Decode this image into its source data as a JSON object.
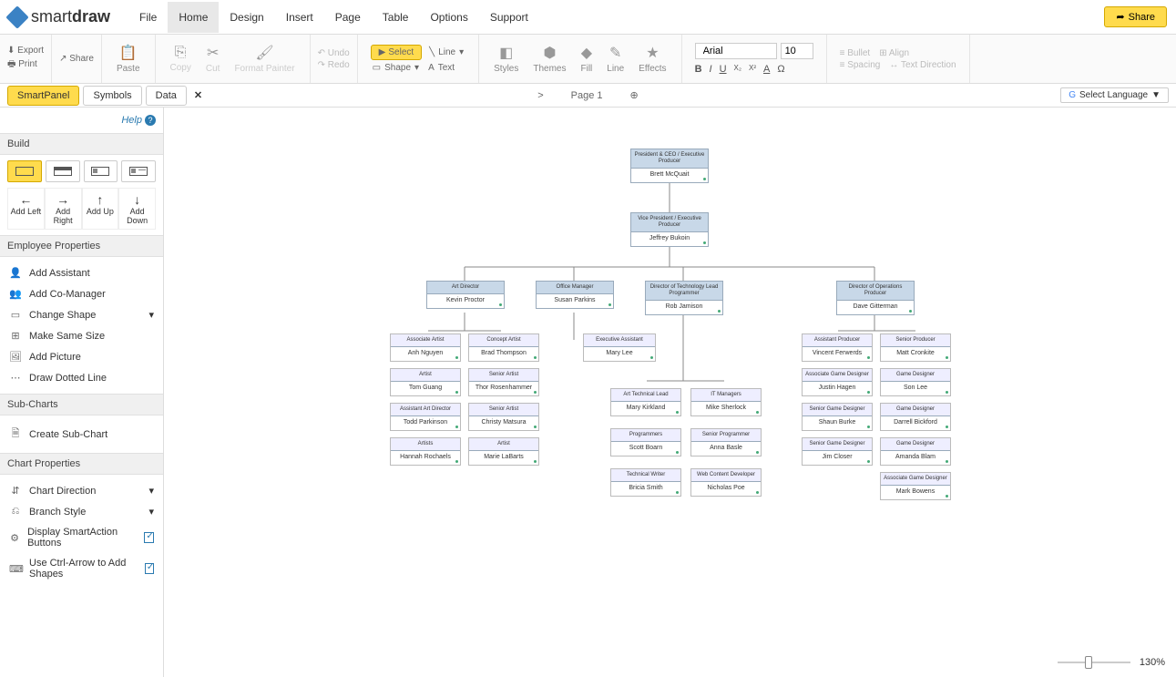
{
  "logo": {
    "brand1": "smart",
    "brand2": "draw"
  },
  "menu": [
    "File",
    "Home",
    "Design",
    "Insert",
    "Page",
    "Table",
    "Options",
    "Support"
  ],
  "menu_active": 1,
  "share": "Share",
  "ribbon": {
    "export": "Export",
    "share": "Share",
    "print": "Print",
    "paste": "Paste",
    "copy": "Copy",
    "cut": "Cut",
    "format_painter": "Format Painter",
    "undo": "Undo",
    "redo": "Redo",
    "select": "Select",
    "shape": "Shape",
    "line": "Line",
    "text": "Text",
    "styles": "Styles",
    "themes": "Themes",
    "fill": "Fill",
    "line_tool": "Line",
    "effects": "Effects",
    "font": "Arial",
    "font_size": "10",
    "bullet": "Bullet",
    "align": "Align",
    "spacing": "Spacing",
    "text_direction": "Text Direction"
  },
  "panel_tabs": [
    "SmartPanel",
    "Symbols",
    "Data"
  ],
  "panel_active": 0,
  "page_label": "Page 1",
  "lang_label": "Select Language",
  "sidebar": {
    "help": "Help",
    "build": "Build",
    "add_left": "Add Left",
    "add_right": "Add Right",
    "add_up": "Add Up",
    "add_down": "Add Down",
    "emp_props": "Employee Properties",
    "add_assistant": "Add Assistant",
    "add_comanager": "Add Co-Manager",
    "change_shape": "Change Shape",
    "make_same": "Make Same Size",
    "add_picture": "Add Picture",
    "draw_dotted": "Draw Dotted Line",
    "subcharts": "Sub-Charts",
    "create_subchart": "Create Sub-Chart",
    "chart_props": "Chart Properties",
    "chart_direction": "Chart Direction",
    "branch_style": "Branch Style",
    "show_smart": "Display SmartAction Buttons",
    "ctrl_arrow": "Use Ctrl-Arrow to Add Shapes"
  },
  "zoom": "130%",
  "org": {
    "ceo": {
      "title": "President & CEO / Executive Producer",
      "name": "Brett McQuait"
    },
    "vp": {
      "title": "Vice President / Executive Producer",
      "name": "Jeffrey Bukoin"
    },
    "dirs": [
      {
        "title": "Art Director",
        "name": "Kevin Proctor"
      },
      {
        "title": "Office Manager",
        "name": "Susan Parkins"
      },
      {
        "title": "Director of Technology Lead Programmer",
        "name": "Rob Jamison"
      },
      {
        "title": "Director of Operations Producer",
        "name": "Dave Gitterman"
      }
    ],
    "col_art_a": [
      {
        "title": "Associate Artist",
        "name": "Anh Nguyen"
      },
      {
        "title": "Artist",
        "name": "Tom Guang"
      },
      {
        "title": "Assistant Art Director",
        "name": "Todd Parkinson"
      },
      {
        "title": "Artists",
        "name": "Hannah Rochaels"
      }
    ],
    "col_art_b": [
      {
        "title": "Concept Artist",
        "name": "Brad Thompson"
      },
      {
        "title": "Senior Artist",
        "name": "Thor Rosenhammer"
      },
      {
        "title": "Senior Artist",
        "name": "Christy Matsura"
      },
      {
        "title": "Artist",
        "name": "Marie LaBarts"
      }
    ],
    "office_assist": {
      "title": "Executive Assistant",
      "name": "Mary Lee"
    },
    "col_tech_a": [
      {
        "title": "Art Technical Lead",
        "name": "Mary Kirkland"
      },
      {
        "title": "Programmers",
        "name": "Scott Boarn"
      },
      {
        "title": "Technical Writer",
        "name": "Bricia Smith"
      }
    ],
    "col_tech_b": [
      {
        "title": "IT Managers",
        "name": "Mike Sherlock"
      },
      {
        "title": "Senior Programmer",
        "name": "Anna Basle"
      },
      {
        "title": "Web Content Developer",
        "name": "Nicholas Poe"
      }
    ],
    "col_ops_a": [
      {
        "title": "Assistant Producer",
        "name": "Vincent Ferwerds"
      },
      {
        "title": "Associate Game Designer",
        "name": "Justin Hagen"
      },
      {
        "title": "Senior Game Designer",
        "name": "Shaun Burke"
      },
      {
        "title": "Senior Game Designer",
        "name": "Jim Closer"
      }
    ],
    "col_ops_b": [
      {
        "title": "Senior Producer",
        "name": "Matt Cronkite"
      },
      {
        "title": "Game Designer",
        "name": "Son Lee"
      },
      {
        "title": "Game Designer",
        "name": "Darrell Bickford"
      },
      {
        "title": "Game Designer",
        "name": "Amanda Blam"
      },
      {
        "title": "Associate Game Designer",
        "name": "Mark Bowens"
      }
    ]
  }
}
